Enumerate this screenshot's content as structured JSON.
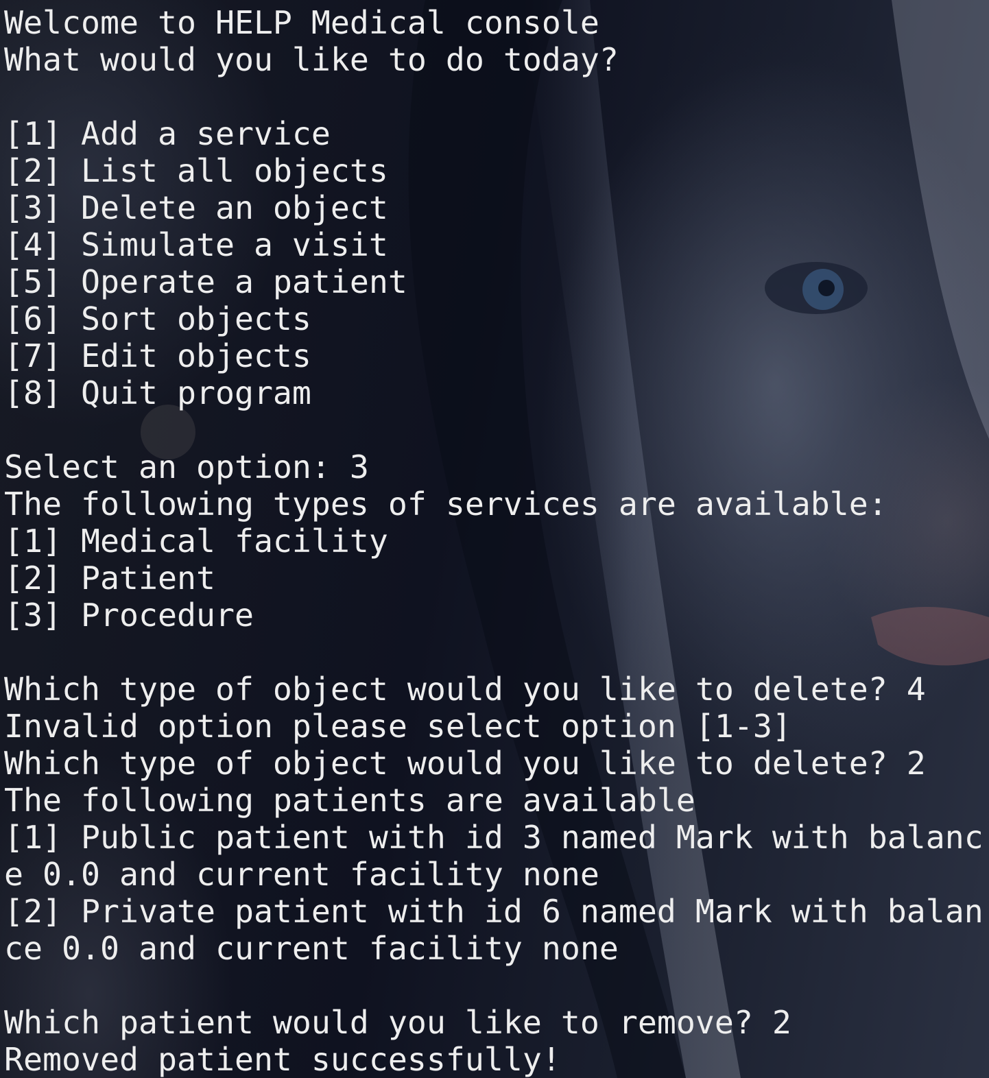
{
  "terminal": {
    "lines": [
      "Welcome to HELP Medical console",
      "What would you like to do today?",
      "",
      "[1] Add a service",
      "[2] List all objects",
      "[3] Delete an object",
      "[4] Simulate a visit",
      "[5] Operate a patient",
      "[6] Sort objects",
      "[7] Edit objects",
      "[8] Quit program",
      "",
      "Select an option: 3",
      "The following types of services are available:",
      "[1] Medical facility",
      "[2] Patient",
      "[3] Procedure",
      "",
      "Which type of object would you like to delete? 4",
      "Invalid option please select option [1-3]",
      "Which type of object would you like to delete? 2",
      "The following patients are available",
      "[1] Public patient with id 3 named Mark with balanc",
      "e 0.0 and current facility none",
      "[2] Private patient with id 6 named Mark with balan",
      "ce 0.0 and current facility none",
      "",
      "Which patient would you like to remove? 2",
      "Removed patient successfully!"
    ]
  },
  "colors": {
    "text": "#eeeeee",
    "background": "#10131c"
  }
}
